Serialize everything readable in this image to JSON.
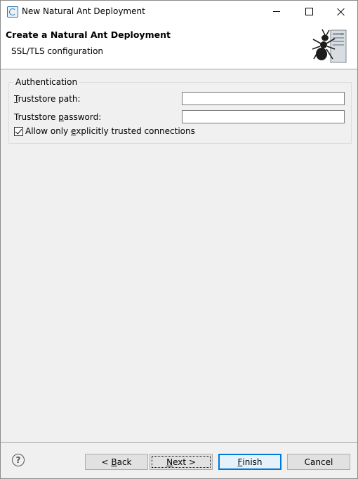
{
  "window": {
    "title": "New Natural Ant Deployment"
  },
  "header": {
    "title": "Create a Natural Ant Deployment",
    "subtitle": "SSL/TLS configuration",
    "graphic_icon": "ant-server-icon"
  },
  "authentication": {
    "legend": "Authentication",
    "truststore_path": {
      "label_mnemonic": "T",
      "label_rest": "ruststore path:",
      "value": ""
    },
    "truststore_password": {
      "label_pre": "Truststore ",
      "label_mnemonic": "p",
      "label_rest": "assword:",
      "value": ""
    },
    "allow_trusted": {
      "label_pre": "Allow only ",
      "label_mnemonic": "e",
      "label_rest": "xplicitly trusted connections",
      "checked": true
    }
  },
  "footer": {
    "help_glyph": "?",
    "back": {
      "prefix": "< ",
      "mnemonic": "B",
      "rest": "ack"
    },
    "next": {
      "mnemonic": "N",
      "rest": "ext >"
    },
    "finish": {
      "mnemonic": "F",
      "rest": "inish"
    },
    "cancel": {
      "label": "Cancel"
    }
  },
  "colors": {
    "dialog_bg": "#f0f0f0",
    "banner_bg": "#ffffff",
    "default_button_border": "#0078d7"
  }
}
